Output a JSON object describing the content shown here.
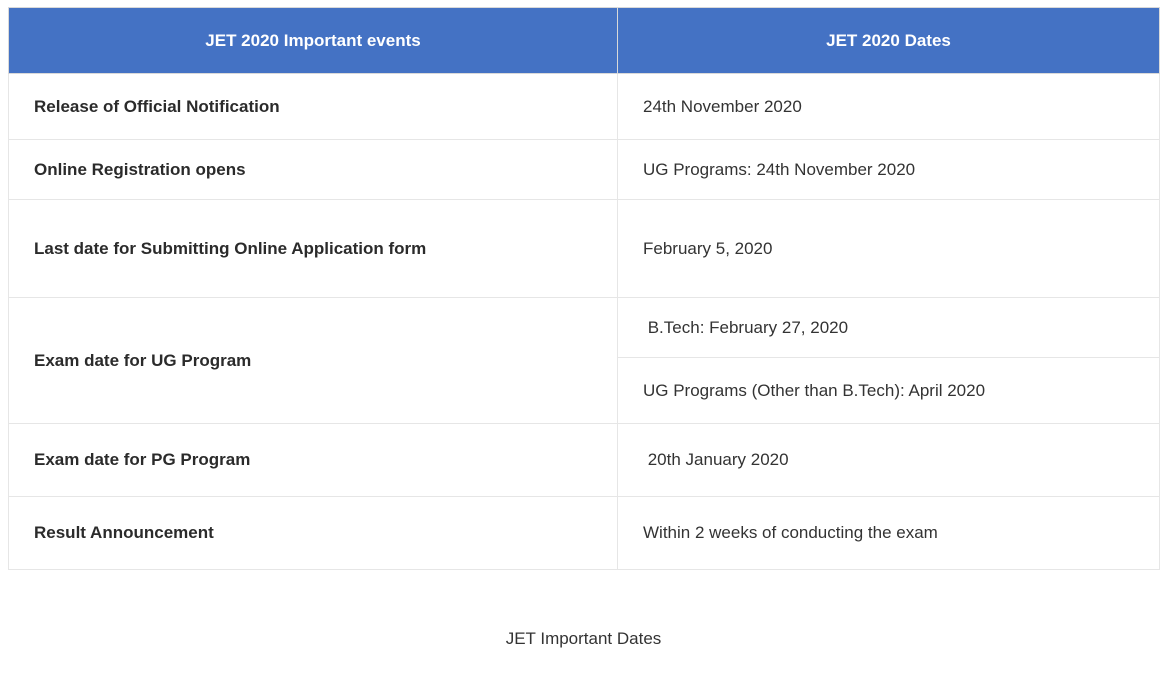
{
  "table": {
    "header": {
      "events": "JET 2020 Important events",
      "dates": "JET 2020 Dates"
    },
    "rows": [
      {
        "event": "Release of Official Notification",
        "dates": [
          "24th November 2020"
        ]
      },
      {
        "event": "Online Registration opens",
        "dates": [
          "UG Programs: 24th November 2020"
        ]
      },
      {
        "event": "Last date for Submitting Online Application form",
        "dates": [
          "February 5, 2020"
        ]
      },
      {
        "event": "Exam date for UG Program",
        "dates": [
          " B.Tech: February 27, 2020",
          "UG Programs (Other than B.Tech): April 2020"
        ]
      },
      {
        "event": "Exam date for PG Program",
        "dates": [
          " 20th January 2020"
        ]
      },
      {
        "event": "Result Announcement",
        "dates": [
          "Within 2 weeks of conducting the exam"
        ]
      }
    ]
  },
  "caption": "JET Important Dates",
  "colors": {
    "header_bg": "#4472c4",
    "header_text": "#ffffff",
    "border": "#e6e6e6"
  }
}
